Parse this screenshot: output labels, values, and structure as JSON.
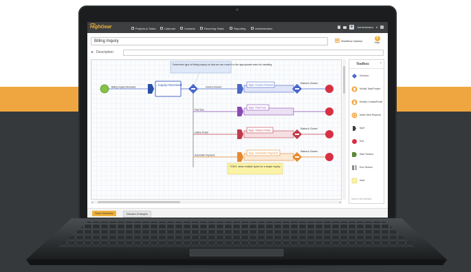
{
  "app": {
    "logo_text": "HighGear",
    "accent_color": "#f0b13b",
    "topbar_color": "#3d3f41"
  },
  "nav": {
    "items": [
      {
        "label": "Projects & Tasks",
        "icon": "clipboard-icon"
      },
      {
        "label": "Calendar",
        "icon": "calendar-icon"
      },
      {
        "label": "Contacts",
        "icon": "contacts-icon"
      },
      {
        "label": "Recurring Tasks",
        "icon": "recurring-icon"
      },
      {
        "label": "Reporting",
        "icon": "chart-icon"
      },
      {
        "label": "Administration",
        "icon": "admin-icon"
      }
    ],
    "user_label": "Administrator"
  },
  "header": {
    "workflow_title": "Billing Inquiry",
    "workflow_options_label": "Workflow Options",
    "help_label": "Help",
    "description_label": "Description"
  },
  "diagram": {
    "start_label": "Billing Inquiry Received",
    "inquiry_step": "Inquiry Received",
    "decision_note": "Determine type of billing inquiry so that we can route it to the appropriate team for handling",
    "todo_note": "TODO: allow multiple types for a single inquiry",
    "branches": [
      {
        "label": "Invoice Amount",
        "type_label": "Type: Invoice Amount",
        "status": "Status is Closed",
        "color": "#4a67c9"
      },
      {
        "label": "Past Due",
        "type_label": "Type: Past Due",
        "status": "Status is Closed",
        "color": "#8a4ab3"
      },
      {
        "label": "Online Portal",
        "type_label": "Type: Online Portal",
        "status": "Status is Closed",
        "color": "#c23a4a"
      },
      {
        "label": "Automatic Payment",
        "type_label": "Type: Automatic Payment",
        "status": "Status is Closed",
        "color": "#e88a2c"
      }
    ]
  },
  "toolbox": {
    "title": "Toolbox",
    "items": [
      {
        "label": "Decision",
        "icon": "decision-icon"
      },
      {
        "label": "Modify Task/Project",
        "icon": "modify-task-icon"
      },
      {
        "label": "Modify Contact/Email",
        "icon": "modify-contact-icon"
      },
      {
        "label": "Make Web Request",
        "icon": "web-request-icon"
      },
      {
        "label": "Split",
        "icon": "split-icon"
      },
      {
        "label": "End",
        "icon": "end-icon"
      },
      {
        "label": "Start Section",
        "icon": "start-section-icon"
      },
      {
        "label": "End Section",
        "icon": "end-section-icon"
      },
      {
        "label": "Note",
        "icon": "note-icon"
      }
    ],
    "footer_text": "Save to the workflow"
  },
  "footer": {
    "save_label": "Save Workflow",
    "discard_label": "Discard Changes"
  }
}
